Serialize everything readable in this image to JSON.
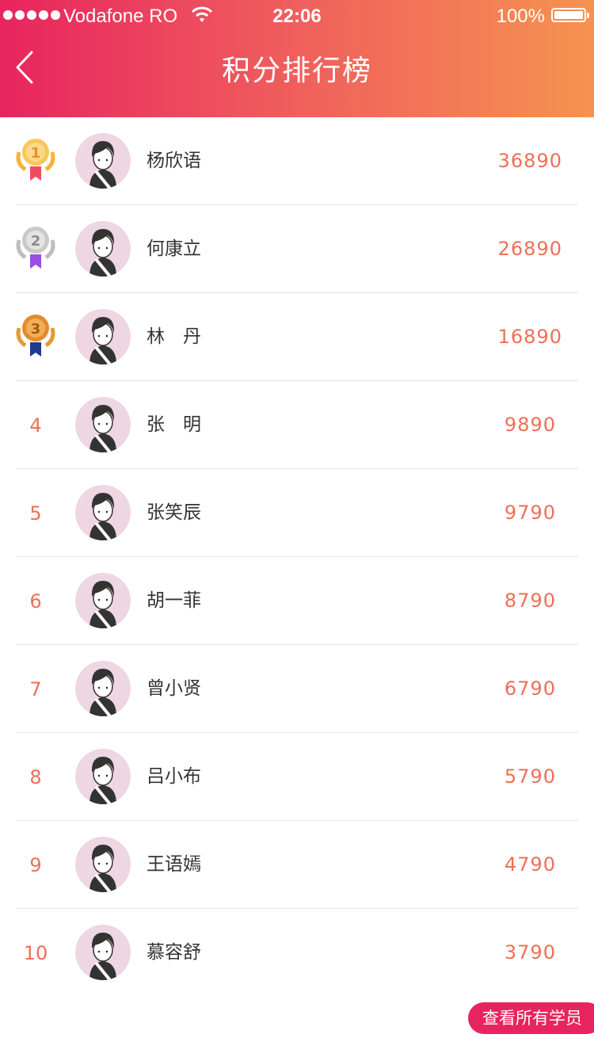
{
  "status": {
    "carrier": "Vodafone RO",
    "time": "22:06",
    "battery": "100%"
  },
  "nav": {
    "title": "积分排行榜"
  },
  "ranking": [
    {
      "rank": "1",
      "name": "杨欣语",
      "score": "36890"
    },
    {
      "rank": "2",
      "name": "何康立",
      "score": "26890"
    },
    {
      "rank": "3",
      "name": "林　丹",
      "score": "16890"
    },
    {
      "rank": "4",
      "name": "张　明",
      "score": "9890"
    },
    {
      "rank": "5",
      "name": "张笑辰",
      "score": "9790"
    },
    {
      "rank": "6",
      "name": "胡一菲",
      "score": "8790"
    },
    {
      "rank": "7",
      "name": "曾小贤",
      "score": "6790"
    },
    {
      "rank": "8",
      "name": "吕小布",
      "score": "5790"
    },
    {
      "rank": "9",
      "name": "王语嫣",
      "score": "4790"
    },
    {
      "rank": "10",
      "name": "慕容舒",
      "score": "3790"
    }
  ],
  "footer": {
    "view_all": "查看所有学员"
  },
  "colors": {
    "accent": "#ee6f55",
    "header_start": "#e8245e",
    "header_end": "#f59350"
  }
}
